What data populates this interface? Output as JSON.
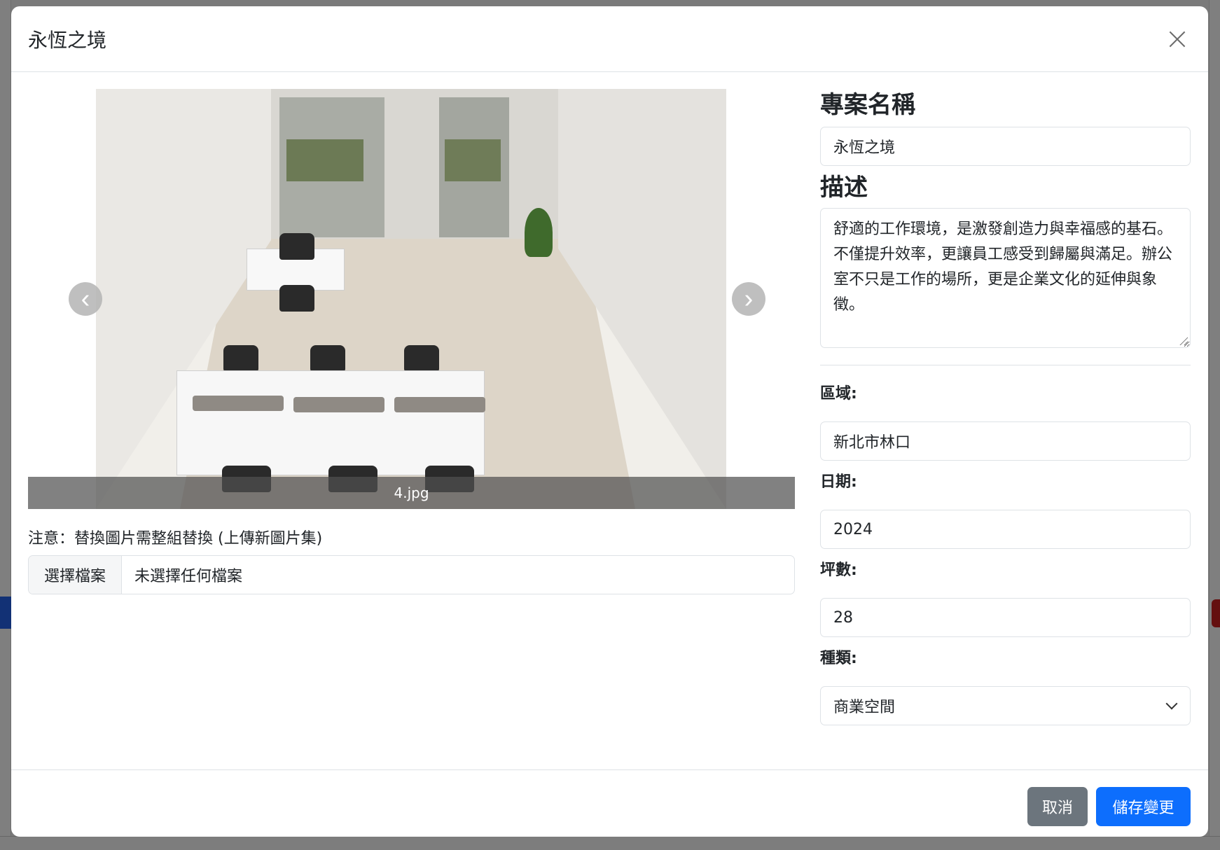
{
  "modal": {
    "title": "永恆之境"
  },
  "carousel": {
    "caption": "4.jpg",
    "prev_glyph": "‹",
    "next_glyph": "›"
  },
  "upload": {
    "note": "注意：替換圖片需整組替換 (上傳新圖片集)",
    "button_label": "選擇檔案",
    "status": "未選擇任何檔案"
  },
  "form": {
    "project_name_label": "專案名稱",
    "project_name_value": "永恆之境",
    "description_label": "描述",
    "description_value": "舒適的工作環境，是激發創造力與幸福感的基石。不僅提升效率，更讓員工感受到歸屬與滿足。辦公室不只是工作的場所，更是企業文化的延伸與象徵。",
    "region_label": "區域:",
    "region_value": "新北市林口",
    "date_label": "日期:",
    "date_value": "2024",
    "area_label": "坪數:",
    "area_value": "28",
    "type_label": "種類:",
    "type_value": "商業空間"
  },
  "footer": {
    "cancel_label": "取消",
    "save_label": "儲存變更"
  },
  "colors": {
    "primary": "#0d6efd",
    "secondary": "#6c757d",
    "overlay": "rgba(0,0,0,0.5)"
  },
  "icons": {
    "close": "close-icon",
    "prev": "chevron-left-icon",
    "next": "chevron-right-icon",
    "select": "chevron-down-icon"
  }
}
